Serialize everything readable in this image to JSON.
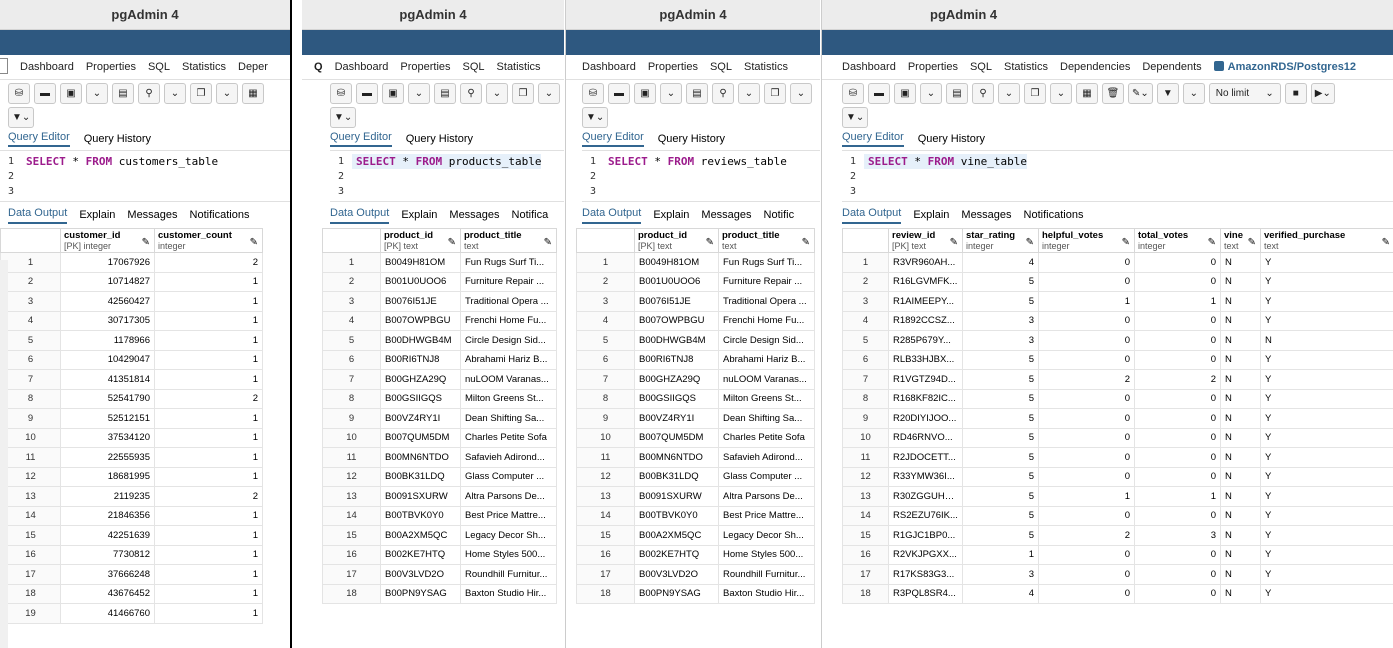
{
  "app_title": "pgAdmin 4",
  "tabs_w1": [
    "Dashboard",
    "Properties",
    "SQL",
    "Statistics",
    "Deper"
  ],
  "tabs_w2": [
    "Dashboard",
    "Properties",
    "SQL",
    "Statistics"
  ],
  "tabs_w3": [
    "Dashboard",
    "Properties",
    "SQL",
    "Statistics"
  ],
  "tabs_w4": [
    "Dashboard",
    "Properties",
    "SQL",
    "Statistics",
    "Dependencies",
    "Dependents",
    "AmazonRDS/Postgres12"
  ],
  "query_tabs": [
    "Query Editor",
    "Query History"
  ],
  "output_tabs_full": [
    "Data Output",
    "Explain",
    "Messages",
    "Notifications"
  ],
  "output_tabs_w2": [
    "Data Output",
    "Explain",
    "Messages",
    "Notifica"
  ],
  "output_tabs_w3": [
    "Data Output",
    "Explain",
    "Messages",
    "Notific"
  ],
  "no_limit": "No limit",
  "sql": {
    "select": "SELECT",
    "star": " * ",
    "from": "FROM",
    "t1": " customers_table",
    "t2": " products_table",
    "t3": " reviews_table",
    "t4": " vine_table"
  },
  "customers": {
    "columns": [
      {
        "name": "customer_id",
        "type": "[PK] integer"
      },
      {
        "name": "customer_count",
        "type": "integer"
      }
    ],
    "rows": [
      [
        "17067926",
        "2"
      ],
      [
        "10714827",
        "1"
      ],
      [
        "42560427",
        "1"
      ],
      [
        "30717305",
        "1"
      ],
      [
        "1178966",
        "1"
      ],
      [
        "10429047",
        "1"
      ],
      [
        "41351814",
        "1"
      ],
      [
        "52541790",
        "2"
      ],
      [
        "52512151",
        "1"
      ],
      [
        "37534120",
        "1"
      ],
      [
        "22555935",
        "1"
      ],
      [
        "18681995",
        "1"
      ],
      [
        "2119235",
        "2"
      ],
      [
        "21846356",
        "1"
      ],
      [
        "42251639",
        "1"
      ],
      [
        "7730812",
        "1"
      ],
      [
        "37666248",
        "1"
      ],
      [
        "43676452",
        "1"
      ],
      [
        "41466760",
        "1"
      ]
    ]
  },
  "products": {
    "columns": [
      {
        "name": "product_id",
        "type": "[PK] text"
      },
      {
        "name": "product_title",
        "type": "text"
      }
    ],
    "rows": [
      [
        "B0049H81OM",
        "Fun Rugs Surf Ti..."
      ],
      [
        "B001U0UOO6",
        "Furniture Repair ..."
      ],
      [
        "B0076I51JE",
        "Traditional Opera ..."
      ],
      [
        "B007OWPBGU",
        "Frenchi Home Fu..."
      ],
      [
        "B00DHWGB4M",
        "Circle Design Sid..."
      ],
      [
        "B00RI6TNJ8",
        "Abrahami Hariz B..."
      ],
      [
        "B00GHZA29Q",
        "nuLOOM Varanas..."
      ],
      [
        "B00GSIIGQS",
        "Milton Greens St..."
      ],
      [
        "B00VZ4RY1I",
        "Dean Shifting Sa..."
      ],
      [
        "B007QUM5DM",
        "Charles Petite Sofa"
      ],
      [
        "B00MN6NTDO",
        "Safavieh Adirond..."
      ],
      [
        "B00BK31LDQ",
        "Glass Computer ..."
      ],
      [
        "B0091SXURW",
        "Altra Parsons De..."
      ],
      [
        "B00TBVK0Y0",
        "Best Price Mattre..."
      ],
      [
        "B00A2XM5QC",
        "Legacy Decor Sh..."
      ],
      [
        "B002KE7HTQ",
        "Home Styles 500..."
      ],
      [
        "B00V3LVD2O",
        "Roundhill Furnitur..."
      ],
      [
        "B00PN9YSAG",
        "Baxton Studio Hir..."
      ]
    ]
  },
  "vine": {
    "columns": [
      {
        "name": "review_id",
        "type": "[PK] text"
      },
      {
        "name": "star_rating",
        "type": "integer"
      },
      {
        "name": "helpful_votes",
        "type": "integer"
      },
      {
        "name": "total_votes",
        "type": "integer"
      },
      {
        "name": "vine",
        "type": "text"
      },
      {
        "name": "verified_purchase",
        "type": "text"
      }
    ],
    "rows": [
      [
        "R3VR960AH...",
        "4",
        "0",
        "0",
        "N",
        "Y"
      ],
      [
        "R16LGVMFK...",
        "5",
        "0",
        "0",
        "N",
        "Y"
      ],
      [
        "R1AIMEEPY...",
        "5",
        "1",
        "1",
        "N",
        "Y"
      ],
      [
        "R1892CCSZ...",
        "3",
        "0",
        "0",
        "N",
        "Y"
      ],
      [
        "R285P679Y...",
        "3",
        "0",
        "0",
        "N",
        "N"
      ],
      [
        "RLB33HJBX...",
        "5",
        "0",
        "0",
        "N",
        "Y"
      ],
      [
        "R1VGTZ94D...",
        "5",
        "2",
        "2",
        "N",
        "Y"
      ],
      [
        "R168KF82IC...",
        "5",
        "0",
        "0",
        "N",
        "Y"
      ],
      [
        "R20DIYIJOO...",
        "5",
        "0",
        "0",
        "N",
        "Y"
      ],
      [
        "RD46RNVO...",
        "5",
        "0",
        "0",
        "N",
        "Y"
      ],
      [
        "R2JDOCETT...",
        "5",
        "0",
        "0",
        "N",
        "Y"
      ],
      [
        "R33YMW36I...",
        "5",
        "0",
        "0",
        "N",
        "Y"
      ],
      [
        "R30ZGGUHZ...",
        "5",
        "1",
        "1",
        "N",
        "Y"
      ],
      [
        "RS2EZU76IK...",
        "5",
        "0",
        "0",
        "N",
        "Y"
      ],
      [
        "R1GJC1BP0...",
        "5",
        "2",
        "3",
        "N",
        "Y"
      ],
      [
        "R2VKJPGXX...",
        "1",
        "0",
        "0",
        "N",
        "Y"
      ],
      [
        "R17KS83G3...",
        "3",
        "0",
        "0",
        "N",
        "Y"
      ],
      [
        "R3PQL8SR4...",
        "4",
        "0",
        "0",
        "N",
        "Y"
      ]
    ]
  },
  "colors": {
    "navbar": "#2e5880",
    "accent": "#326690",
    "keyword": "#9c1c8c"
  }
}
